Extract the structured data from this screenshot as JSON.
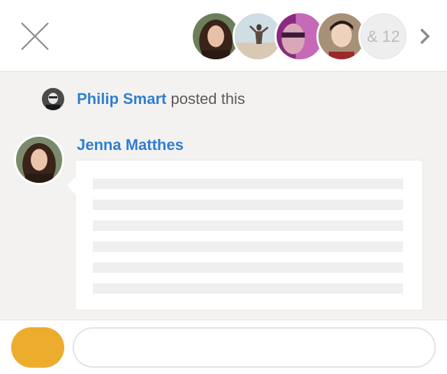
{
  "header": {
    "participants": [
      {
        "name": "participant-1"
      },
      {
        "name": "participant-2"
      },
      {
        "name": "participant-3"
      },
      {
        "name": "participant-4"
      }
    ],
    "more_count": "& 12"
  },
  "post": {
    "poster_name": "Philip Smart",
    "posted_suffix": " posted this"
  },
  "comment": {
    "author": "Jenna Matthes",
    "placeholder_lines": 6
  },
  "footer": {
    "reply_value": "",
    "reply_placeholder": ""
  },
  "colors": {
    "link": "#2f7fd1",
    "action": "#ecac2e",
    "background": "#f3f2f0"
  }
}
